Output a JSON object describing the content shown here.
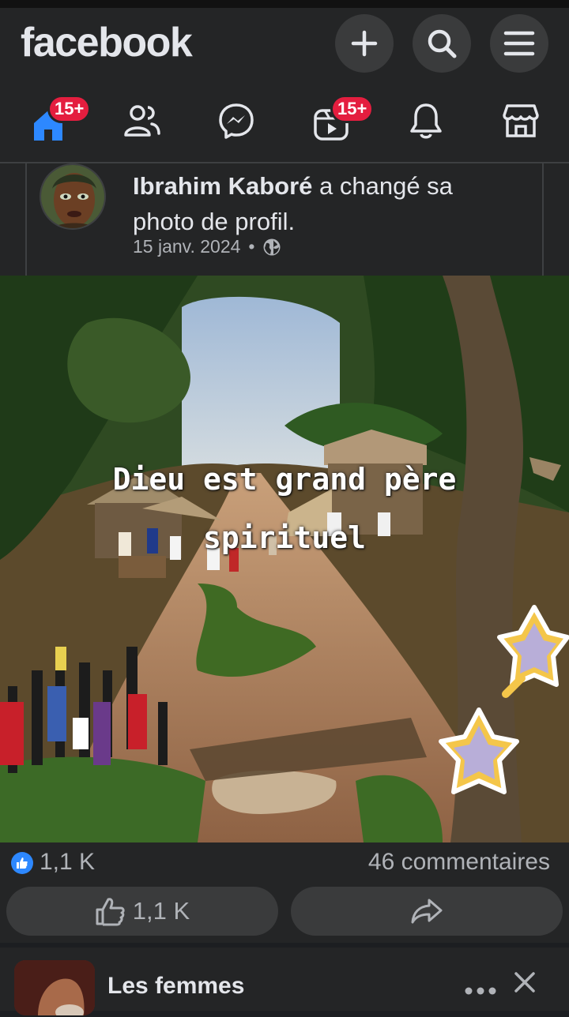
{
  "header": {
    "logo": "facebook",
    "actions": [
      {
        "icon": "plus-icon"
      },
      {
        "icon": "search-icon"
      },
      {
        "icon": "menu-icon"
      }
    ],
    "nav": [
      {
        "icon": "home-icon",
        "badge": "15+",
        "active": true
      },
      {
        "icon": "friends-icon"
      },
      {
        "icon": "messenger-icon"
      },
      {
        "icon": "reels-icon",
        "badge": "15+"
      },
      {
        "icon": "bell-icon"
      },
      {
        "icon": "marketplace-icon"
      }
    ]
  },
  "post": {
    "author": "Ibrahim Kaboré",
    "action": " a changé sa photo de profil.",
    "date": "15 janv. 2024",
    "separator": "•",
    "privacy_icon": "globe-icon",
    "image": {
      "overlay_line1": "Dieu est grand père",
      "overlay_line2": "spirituel"
    },
    "likes_count": "1,1 K",
    "comments_label": "46 commentaires",
    "like_button_label": "1,1 K",
    "share_icon": "share-icon"
  },
  "next_post": {
    "title": "Les femmes",
    "more_icon": "more-icon",
    "close_icon": "close-icon"
  },
  "colors": {
    "background": "#1c1e21",
    "surface": "#242526",
    "button": "#3a3b3c",
    "accent": "#2d88ff",
    "badge": "#e41e3f",
    "text": "#e4e6eb",
    "muted": "#b0b3b8"
  }
}
